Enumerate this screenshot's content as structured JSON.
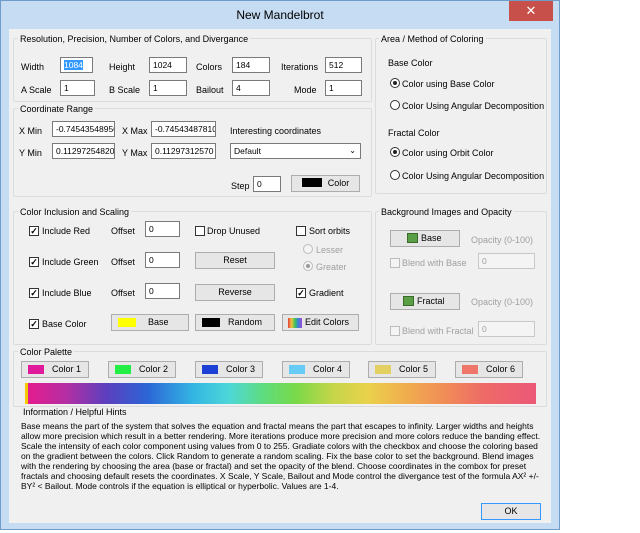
{
  "window": {
    "title": "New Mandelbrot",
    "close_glyph": "✕"
  },
  "groups": {
    "resolution": "Resolution, Precision, Number of Colors, and Divergance",
    "area": "Area / Method of Coloring",
    "coord": "Coordinate Range",
    "color_inclusion": "Color Inclusion and Scaling",
    "background": "Background Images and Opacity",
    "palette": "Color Palette",
    "info": "Information / Helpful Hints"
  },
  "resolution": {
    "width_label": "Width",
    "width_value": "1084",
    "height_label": "Height",
    "height_value": "1024",
    "colors_label": "Colors",
    "colors_value": "184",
    "iterations_label": "Iterations",
    "iterations_value": "512",
    "ascale_label": "A Scale",
    "ascale_value": "1",
    "bscale_label": "B Scale",
    "bscale_value": "1",
    "bailout_label": "Bailout",
    "bailout_value": "4",
    "mode_label": "Mode",
    "mode_value": "1"
  },
  "area": {
    "base_color_label": "Base Color",
    "base_opt1": "Color using Base Color",
    "base_opt2": "Color Using Angular Decomposition",
    "fractal_color_label": "Fractal Color",
    "fractal_opt1": "Color using Orbit Color",
    "fractal_opt2": "Color Using Angular Decomposition"
  },
  "coord": {
    "xmin_label": "X Min",
    "xmin_value": "-0.74543548950",
    "xmax_label": "X Max",
    "xmax_value": "-0.74543487810",
    "ymin_label": "Y Min",
    "ymin_value": "0.11297254820",
    "ymax_label": "Y Max",
    "ymax_value": "0.11297312570",
    "interesting_label": "Interesting coordinates",
    "interesting_value": "Default",
    "step_label": "Step",
    "step_value": "0",
    "color_button": "Color"
  },
  "inclusion": {
    "include_red": "Include Red",
    "include_green": "Include Green",
    "include_blue": "Include Blue",
    "base_color": "Base Color",
    "offset_label": "Offset",
    "offset_red": "0",
    "offset_green": "0",
    "offset_blue": "0",
    "drop_unused": "Drop Unused",
    "reset": "Reset",
    "reverse": "Reverse",
    "base_button": "Base",
    "random_button": "Random",
    "sort_orbits": "Sort orbits",
    "lesser": "Lesser",
    "greater": "Greater",
    "gradient": "Gradient",
    "edit_colors": "Edit Colors"
  },
  "background": {
    "base_button": "Base",
    "opacity_label": "Opacity (0-100)",
    "blend_base": "Blend with Base",
    "blend_base_value": "0",
    "fractal_button": "Fractal",
    "opacity_label2": "Opacity (0-100)",
    "blend_fractal": "Blend with Fractal",
    "blend_fractal_value": "0"
  },
  "palette": {
    "colors": [
      {
        "label": "Color 1",
        "hex": "#e01a9a"
      },
      {
        "label": "Color 2",
        "hex": "#22ee44"
      },
      {
        "label": "Color 3",
        "hex": "#1c3fd6"
      },
      {
        "label": "Color 4",
        "hex": "#66ccf6"
      },
      {
        "label": "Color 5",
        "hex": "#e3d063"
      },
      {
        "label": "Color 6",
        "hex": "#ef7769"
      }
    ]
  },
  "colors": {
    "coord_color_swatch": "#000000",
    "base_swatch": "#ffff00",
    "random_swatch": "#000000"
  },
  "info_text": "Base means the part of the system that solves the equation and fractal means the part that escapes to infinity. Larger widths and heights allow more precision which result in a better rendering. More iterations produce more precision and more colors reduce the banding effect. Scale the intensity of each color component using values from 0 to 255. Gradiate colors with the checkbox and choose the coloring based on the gradient between the colors. Click Random to generate a random scaling. Fix the base color to set the background. Blend images with the rendering by choosing the area (base or fractal) and set the opacity of the blend. Choose coordinates in the combox for preset fractals and choosing default resets the coordinates. X Scale, Y Scale, Bailout and Mode control the divergance test of the formula AX² +/- BY² < Bailout.  Mode controls if the equation is elliptical or hyperbolic. Values are 1-4.",
  "ok_button": "OK"
}
